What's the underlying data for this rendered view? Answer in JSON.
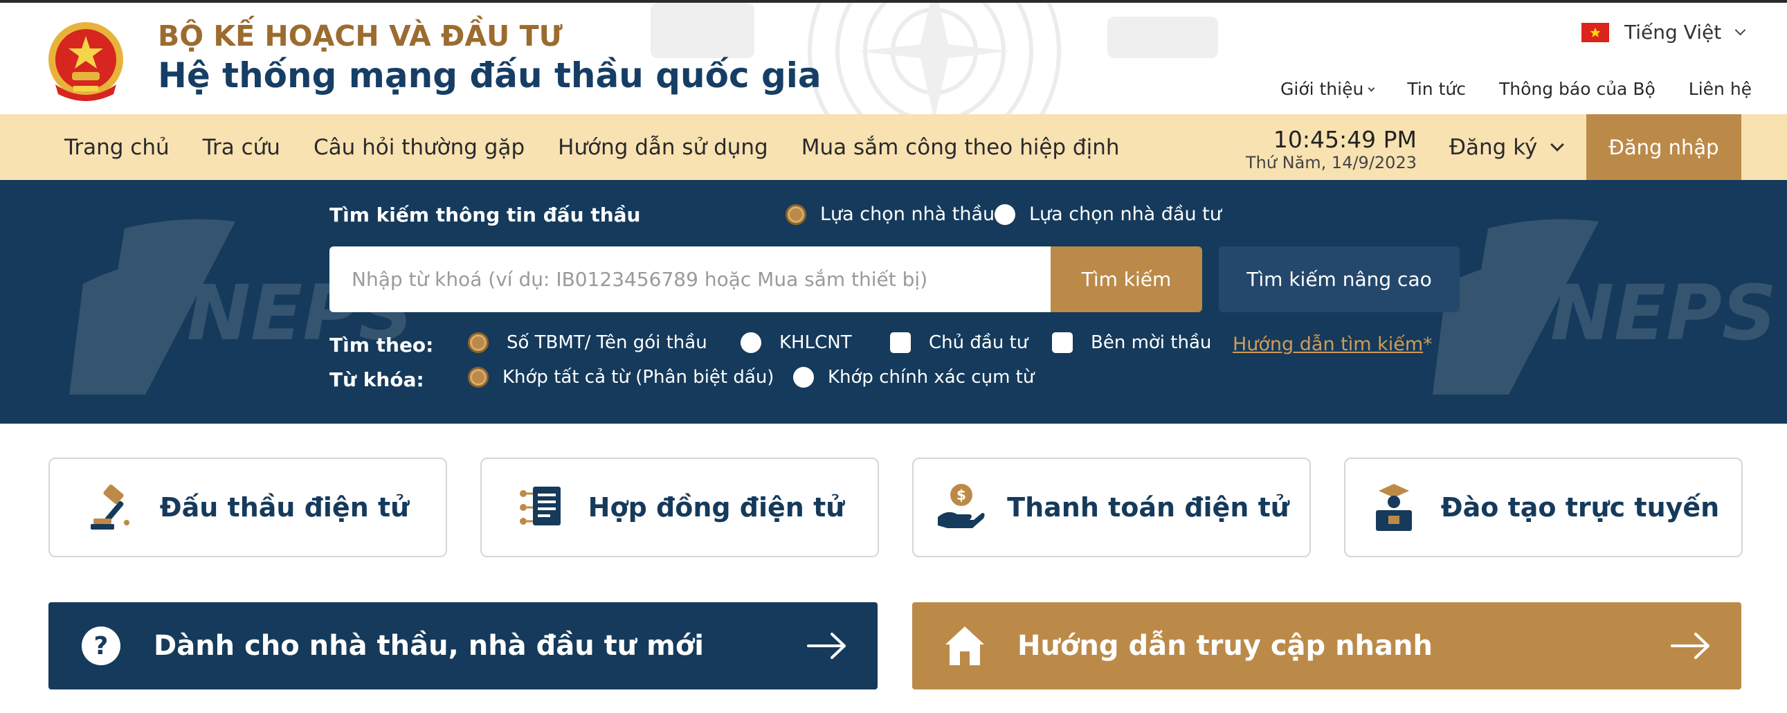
{
  "header": {
    "ministry": "BỘ KẾ HOẠCH VÀ ĐẦU TƯ",
    "system_title": "Hệ thống mạng đấu thầu quốc gia",
    "language": "Tiếng Việt",
    "top_nav": [
      "Giới thiệu",
      "Tin tức",
      "Thông báo của Bộ",
      "Liên hệ"
    ]
  },
  "main_nav": {
    "items": [
      "Trang chủ",
      "Tra cứu",
      "Câu hỏi thường gặp",
      "Hướng dẫn sử dụng",
      "Mua sắm công theo hiệp định"
    ],
    "time": "10:45:49 PM",
    "date": "Thứ Năm, 14/9/2023",
    "register": "Đăng ký",
    "login": "Đăng nhập"
  },
  "search": {
    "heading": "Tìm kiếm thông tin đấu thầu",
    "mode_contractor": "Lựa chọn nhà thầu",
    "mode_investor": "Lựa chọn nhà đầu tư",
    "placeholder": "Nhập từ khoá (ví dụ: IB0123456789 hoặc Mua sắm thiết bị)",
    "search_button": "Tìm kiếm",
    "advanced_button": "Tìm kiếm nâng cao",
    "search_by_label": "Tìm theo:",
    "search_by_options": [
      "Số TBMT/ Tên gói thầu",
      "KHLCNT",
      "Chủ đầu tư",
      "Bên mời thầu"
    ],
    "keyword_label": "Từ khóa:",
    "keyword_options": [
      "Khớp tất cả từ (Phân biệt dấu)",
      "Khớp chính xác cụm từ"
    ],
    "guide_link": "Hướng dẫn tìm kiếm",
    "guide_star": "*"
  },
  "services": [
    "Đấu thầu điện tử",
    "Hợp đồng điện tử",
    "Thanh toán điện tử",
    "Đào tạo trực tuyến"
  ],
  "banners": {
    "new_users": "Dành cho nhà thầu, nhà đầu tư mới",
    "quick_access": "Hướng dẫn truy cập nhanh"
  },
  "watermark_text": "NEPS",
  "colors": {
    "navy": "#153a5b",
    "gold": "#bc8a48",
    "nav_bg": "#f8e2b2",
    "ministry_text": "#9c6b30"
  },
  "icons": [
    "vietnam-emblem",
    "vietnam-flag",
    "auction-gavel-icon",
    "contract-document-icon",
    "payment-hand-icon",
    "online-training-icon",
    "question-circle-icon",
    "home-icon",
    "arrow-right-icon"
  ]
}
